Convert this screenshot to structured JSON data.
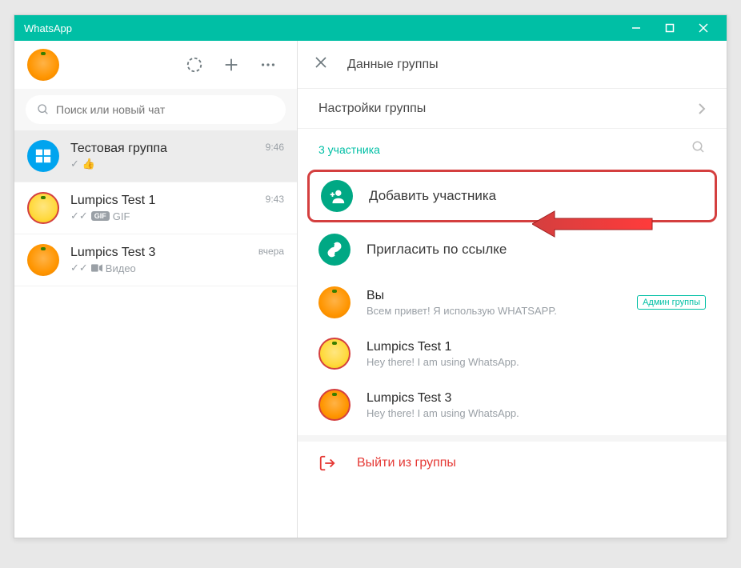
{
  "titlebar": {
    "title": "WhatsApp"
  },
  "left": {
    "search_placeholder": "Поиск или новый чат",
    "chats": [
      {
        "title": "Тестовая группа",
        "sub_prefix": "✓",
        "sub_emoji": "👍",
        "time": "9:46"
      },
      {
        "title": "Lumpics Test 1",
        "sub_checks": "✓✓",
        "sub_badge": "GIF",
        "sub_text": "GIF",
        "time": "9:43"
      },
      {
        "title": "Lumpics Test 3",
        "sub_checks": "✓✓",
        "sub_icon": "video",
        "sub_text": "Видео",
        "time": "вчера"
      }
    ]
  },
  "right": {
    "header_title": "Данные группы",
    "settings_label": "Настройки группы",
    "participants_count": "3 участника",
    "add_participant": "Добавить участника",
    "invite_link": "Пригласить по ссылке",
    "members": [
      {
        "name": "Вы",
        "status": "Всем привет! Я использую WHATSAPP.",
        "admin": "Админ группы"
      },
      {
        "name": "Lumpics Test 1",
        "status": "Hey there! I am using WhatsApp."
      },
      {
        "name": "Lumpics Test 3",
        "status": "Hey there! I am using WhatsApp."
      }
    ],
    "exit_label": "Выйти из группы"
  }
}
